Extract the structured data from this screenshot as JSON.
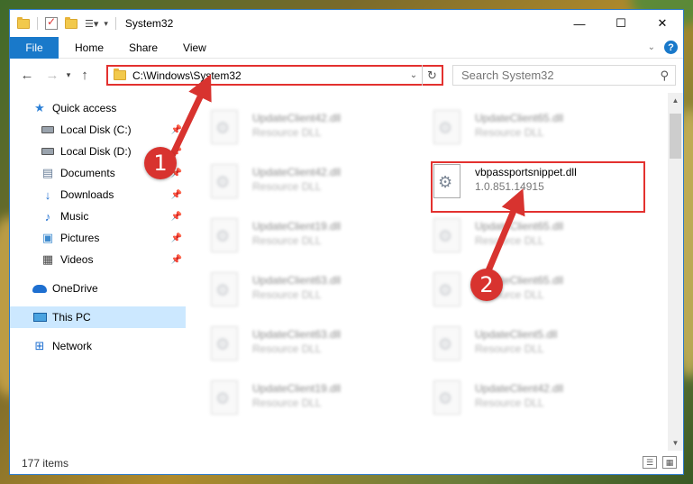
{
  "window": {
    "title": "System32",
    "controls": {
      "minimize": "—",
      "maximize": "☐",
      "close": "✕"
    }
  },
  "ribbon": {
    "tabs": [
      "File",
      "Home",
      "Share",
      "View"
    ]
  },
  "nav": {
    "address": "C:\\Windows\\System32",
    "search_placeholder": "Search System32"
  },
  "sidebar": {
    "items": [
      {
        "label": "Quick access",
        "icon": "star-icon",
        "pinned": false
      },
      {
        "label": "Local Disk (C:)",
        "icon": "drive-icon",
        "pinned": true
      },
      {
        "label": "Local Disk (D:)",
        "icon": "drive-icon",
        "pinned": true
      },
      {
        "label": "Documents",
        "icon": "documents-icon",
        "pinned": true
      },
      {
        "label": "Downloads",
        "icon": "downloads-icon",
        "pinned": true
      },
      {
        "label": "Music",
        "icon": "music-icon",
        "pinned": true
      },
      {
        "label": "Pictures",
        "icon": "pictures-icon",
        "pinned": true
      },
      {
        "label": "Videos",
        "icon": "videos-icon",
        "pinned": true
      },
      {
        "label": "OneDrive",
        "icon": "onedrive-icon",
        "pinned": false
      },
      {
        "label": "This PC",
        "icon": "pc-icon",
        "pinned": false,
        "selected": true
      },
      {
        "label": "Network",
        "icon": "network-icon",
        "pinned": false
      }
    ]
  },
  "files": {
    "left": [
      {
        "name": "UpdateClient42.dll",
        "type": "Resource DLL"
      },
      {
        "name": "UpdateClient42.dll",
        "type": "Resource DLL"
      },
      {
        "name": "UpdateClient19.dll",
        "type": "Resource DLL"
      },
      {
        "name": "UpdateClient63.dll",
        "type": "Resource DLL"
      },
      {
        "name": "UpdateClient63.dll",
        "type": "Resource DLL"
      },
      {
        "name": "UpdateClient19.dll",
        "type": "Resource DLL"
      }
    ],
    "right": [
      {
        "name": "UpdateClient65.dll",
        "type": "Resource DLL"
      },
      {
        "name": "vbpassportsnippet.dll",
        "type": "1.0.851.14915",
        "highlight": true
      },
      {
        "name": "UpdateClient65.dll",
        "type": "Resource DLL"
      },
      {
        "name": "UpdateClient65.dll",
        "type": "Resource DLL"
      },
      {
        "name": "UpdateClient5.dll",
        "type": "Resource DLL"
      },
      {
        "name": "UpdateClient42.dll",
        "type": "Resource DLL"
      }
    ]
  },
  "status": {
    "items": "177 items"
  },
  "annotations": {
    "step1": "1",
    "step2": "2"
  },
  "colors": {
    "accent": "#1979ca",
    "highlight": "#e3312f",
    "selected": "#cce8ff"
  }
}
